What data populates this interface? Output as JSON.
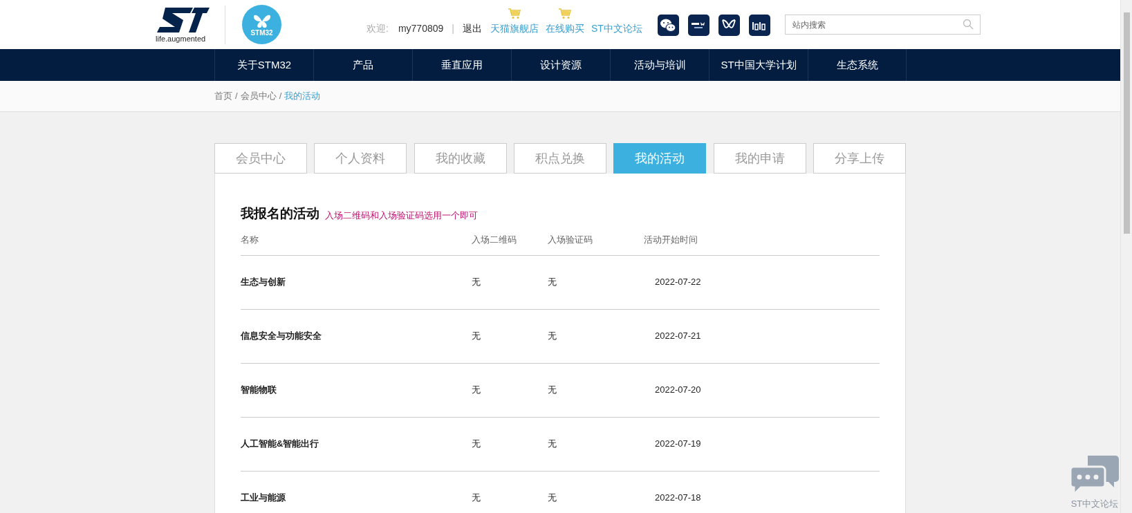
{
  "header": {
    "logo_tagline": "life.augmented",
    "product_badge": "STM32",
    "welcome_label": "欢迎:",
    "username": "my770809",
    "separator": "|",
    "logout": "退出",
    "links": [
      {
        "label": "天猫旗舰店",
        "cart": true
      },
      {
        "label": "在线购买",
        "cart": true
      },
      {
        "label": "ST中文论坛",
        "cart": false
      }
    ],
    "social": [
      {
        "kind": "wechat"
      },
      {
        "kind": "finder"
      },
      {
        "kind": "wave"
      },
      {
        "kind": "bilibili"
      }
    ],
    "search": {
      "placeholder": "站内搜索"
    }
  },
  "nav": [
    "关于STM32",
    "产品",
    "垂直应用",
    "设计资源",
    "活动与培训",
    "ST中国大学计划",
    "生态系统"
  ],
  "breadcrumb": {
    "separator": "/",
    "items": [
      {
        "label": "首页",
        "current": false
      },
      {
        "label": "会员中心",
        "current": false
      },
      {
        "label": "我的活动",
        "current": true
      }
    ]
  },
  "tabs": [
    {
      "label": "会员中心",
      "selected": false
    },
    {
      "label": "个人资料",
      "selected": false
    },
    {
      "label": "我的收藏",
      "selected": false
    },
    {
      "label": "积点兑换",
      "selected": false
    },
    {
      "label": "我的活动",
      "selected": true
    },
    {
      "label": "我的申请",
      "selected": false
    },
    {
      "label": "分享上传",
      "selected": false
    }
  ],
  "section": {
    "title": "我报名的活动",
    "hint": "入场二维码和入场验证码选用一个即可"
  },
  "table": {
    "columns": [
      "名称",
      "入场二维码",
      "入场验证码",
      "活动开始时间"
    ],
    "rows": [
      [
        "生态与创新",
        "无",
        "无",
        "2022-07-22"
      ],
      [
        "信息安全与功能安全",
        "无",
        "无",
        "2022-07-21"
      ],
      [
        "智能物联",
        "无",
        "无",
        "2022-07-20"
      ],
      [
        "人工智能&智能出行",
        "无",
        "无",
        "2022-07-19"
      ],
      [
        "工业与能源",
        "无",
        "无",
        "2022-07-18"
      ]
    ]
  },
  "chat_widget": {
    "label": "ST中文论坛"
  }
}
